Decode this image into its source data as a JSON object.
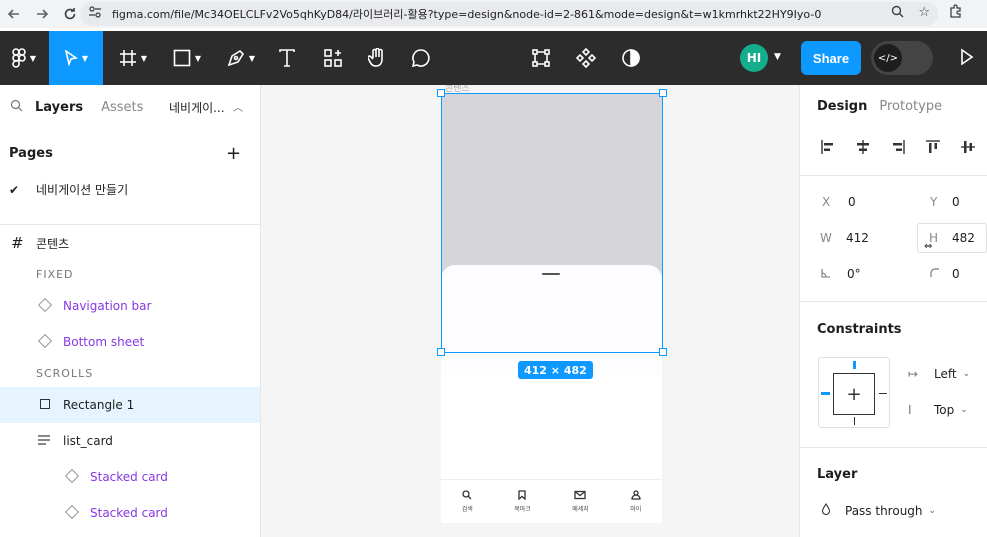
{
  "browser": {
    "url": "figma.com/file/Mc34OELCLFv2Vo5qhKyD84/라이브러리-활용?type=design&node-id=2-861&mode=design&t=w1kmrhkt22HY9Iyo-0"
  },
  "toolbar": {
    "share_label": "Share",
    "avatar_initials": "HI",
    "avatar_color": "#14ae8c",
    "accent_color": "#0d99ff"
  },
  "left_panel": {
    "tabs": [
      "Layers",
      "Assets"
    ],
    "file_name": "네비게이...",
    "pages_title": "Pages",
    "pages": [
      {
        "name": "네비게이션 만들기",
        "selected": true
      }
    ],
    "layers": [
      {
        "label": "콘텐츠",
        "kind": "frame"
      },
      {
        "label": "FIXED",
        "kind": "section"
      },
      {
        "label": "Navigation bar",
        "kind": "component"
      },
      {
        "label": "Bottom sheet",
        "kind": "component"
      },
      {
        "label": "SCROLLS",
        "kind": "section"
      },
      {
        "label": "Rectangle 1",
        "kind": "rectangle",
        "selected": true
      },
      {
        "label": "list_card",
        "kind": "autolayout"
      },
      {
        "label": "Stacked card",
        "kind": "component"
      },
      {
        "label": "Stacked card",
        "kind": "component"
      }
    ]
  },
  "canvas": {
    "frame_label": "콘텐츠",
    "dimension_label": "412 × 482",
    "nav_items": [
      "검색",
      "북마크",
      "메세지",
      "마이"
    ]
  },
  "right_panel": {
    "tabs": [
      "Design",
      "Prototype"
    ],
    "x_label": "X",
    "x_value": "0",
    "y_label": "Y",
    "y_value": "0",
    "w_label": "W",
    "w_value": "412",
    "h_label": "H",
    "h_value": "482",
    "rotation_value": "0°",
    "radius_value": "0",
    "constraints_title": "Constraints",
    "horizontal_constraint": "Left",
    "vertical_constraint": "Top",
    "layer_title": "Layer",
    "blend_mode": "Pass through"
  }
}
